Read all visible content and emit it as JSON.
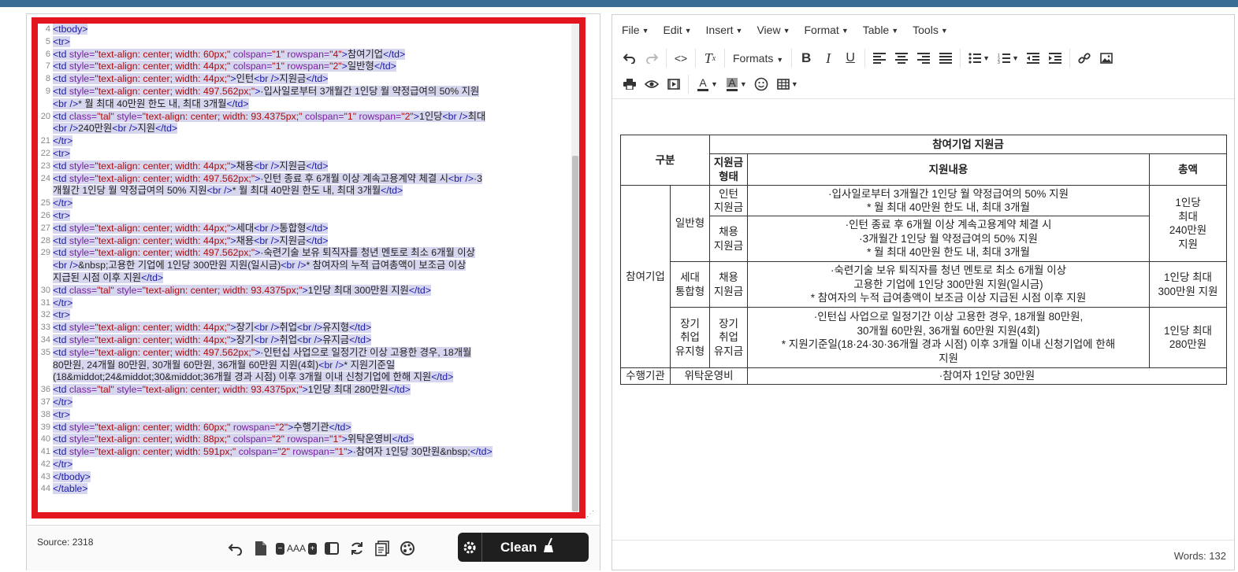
{
  "source_editor": {
    "lines": [
      {
        "n": "4",
        "html": "<span class=\"tag\">&lt;tbody&gt;</span>"
      },
      {
        "n": "5",
        "html": "<span class=\"tag\">&lt;tr&gt;</span>"
      },
      {
        "n": "6",
        "html": "<span class=\"tag\">&lt;td</span> <span class=\"attr\">style=</span><span class=\"str\">\"text-align: center; width: 60px;\"</span> <span class=\"attr\">colspan=</span><span class=\"str\">\"1\"</span> <span class=\"attr\">rowspan=</span><span class=\"str\">\"4\"</span><span class=\"tag\">&gt;</span>참여기업<span class=\"tag\">&lt;/td&gt;</span>"
      },
      {
        "n": "7",
        "html": "<span class=\"tag\">&lt;td</span> <span class=\"attr\">style=</span><span class=\"str\">\"text-align: center; width: 44px;\"</span> <span class=\"attr\">colspan=</span><span class=\"str\">\"1\"</span> <span class=\"attr\">rowspan=</span><span class=\"str\">\"2\"</span><span class=\"tag\">&gt;</span>일반형<span class=\"tag\">&lt;/td&gt;</span>"
      },
      {
        "n": "8",
        "html": "<span class=\"tag\">&lt;td</span> <span class=\"attr\">style=</span><span class=\"str\">\"text-align: center; width: 44px;\"</span><span class=\"tag\">&gt;</span>인턴<span class=\"tag\">&lt;br /&gt;</span>지원금<span class=\"tag\">&lt;/td&gt;</span>"
      },
      {
        "n": "9",
        "html": "<span class=\"tag\">&lt;td</span> <span class=\"attr\">style=</span><span class=\"str\">\"text-align: center; width: 497.562px;\"</span><span class=\"tag\">&gt;</span>·입사일로부터 3개월간 1인당 월 약정급여의 50% 지원<br><span class=\"tag\">&lt;br /&gt;</span>* 월 최대 40만원 한도 내, 최대 3개월<span class=\"tag\">&lt;/td&gt;</span>"
      },
      {
        "n": "20",
        "html": "<span class=\"tag\">&lt;td</span> <span class=\"attr\">class=</span><span class=\"str\">\"tal\"</span> <span class=\"attr\">style=</span><span class=\"str\">\"text-align: center; width: 93.4375px;\"</span> <span class=\"attr\">colspan=</span><span class=\"str\">\"1\"</span> <span class=\"attr\">rowspan=</span><span class=\"str\">\"2\"</span><span class=\"tag\">&gt;</span>1인당<span class=\"tag\">&lt;br /&gt;</span>최대<br><span class=\"tag\">&lt;br /&gt;</span>240만원<span class=\"tag\">&lt;br /&gt;</span>지원<span class=\"tag\">&lt;/td&gt;</span>"
      },
      {
        "n": "21",
        "html": "<span class=\"tag\">&lt;/tr&gt;</span>"
      },
      {
        "n": "22",
        "html": "<span class=\"tag\">&lt;tr&gt;</span>"
      },
      {
        "n": "23",
        "html": "<span class=\"tag\">&lt;td</span> <span class=\"attr\">style=</span><span class=\"str\">\"text-align: center; width: 44px;\"</span><span class=\"tag\">&gt;</span>채용<span class=\"tag\">&lt;br /&gt;</span>지원금<span class=\"tag\">&lt;/td&gt;</span>"
      },
      {
        "n": "24",
        "html": "<span class=\"tag\">&lt;td</span> <span class=\"attr\">style=</span><span class=\"str\">\"text-align: center; width: 497.562px;\"</span><span class=\"tag\">&gt;</span>·인턴 종료 후 6개월 이상 계속고용계약 체결 시<span class=\"tag\">&lt;br /&gt;</span>·3<br>개월간 1인당 월 약정급여의 50% 지원<span class=\"tag\">&lt;br /&gt;</span>* 월 최대 40만원 한도 내, 최대 3개월<span class=\"tag\">&lt;/td&gt;</span>"
      },
      {
        "n": "25",
        "html": "<span class=\"tag\">&lt;/tr&gt;</span>"
      },
      {
        "n": "26",
        "html": "<span class=\"tag\">&lt;tr&gt;</span>"
      },
      {
        "n": "27",
        "html": "<span class=\"tag\">&lt;td</span> <span class=\"attr\">style=</span><span class=\"str\">\"text-align: center; width: 44px;\"</span><span class=\"tag\">&gt;</span>세대<span class=\"tag\">&lt;br /&gt;</span>통합형<span class=\"tag\">&lt;/td&gt;</span>"
      },
      {
        "n": "28",
        "html": "<span class=\"tag\">&lt;td</span> <span class=\"attr\">style=</span><span class=\"str\">\"text-align: center; width: 44px;\"</span><span class=\"tag\">&gt;</span>채용<span class=\"tag\">&lt;br /&gt;</span>지원금<span class=\"tag\">&lt;/td&gt;</span>"
      },
      {
        "n": "29",
        "html": "<span class=\"tag\">&lt;td</span> <span class=\"attr\">style=</span><span class=\"str\">\"text-align: center; width: 497.562px;\"</span><span class=\"tag\">&gt;</span>·숙련기술 보유 퇴직자를 청년 멘토로 최소 6개월 이상<br><span class=\"tag\">&lt;br /&gt;</span>&amp;nbsp;고용한 기업에 1인당 300만원 지원(일시금)<span class=\"tag\">&lt;br /&gt;</span>* 참여자의 누적 급여총액이 보조금 이상<br>지급된 시점 이후 지원<span class=\"tag\">&lt;/td&gt;</span>"
      },
      {
        "n": "30",
        "html": "<span class=\"tag\">&lt;td</span> <span class=\"attr\">class=</span><span class=\"str\">\"tal\"</span> <span class=\"attr\">style=</span><span class=\"str\">\"text-align: center; width: 93.4375px;\"</span><span class=\"tag\">&gt;</span>1인당 최대 300만원 지원<span class=\"tag\">&lt;/td&gt;</span>"
      },
      {
        "n": "31",
        "html": "<span class=\"tag\">&lt;/tr&gt;</span>"
      },
      {
        "n": "32",
        "html": "<span class=\"tag\">&lt;tr&gt;</span>"
      },
      {
        "n": "33",
        "html": "<span class=\"tag\">&lt;td</span> <span class=\"attr\">style=</span><span class=\"str\">\"text-align: center; width: 44px;\"</span><span class=\"tag\">&gt;</span>장기<span class=\"tag\">&lt;br /&gt;</span>취업<span class=\"tag\">&lt;br /&gt;</span>유지형<span class=\"tag\">&lt;/td&gt;</span>"
      },
      {
        "n": "34",
        "html": "<span class=\"tag\">&lt;td</span> <span class=\"attr\">style=</span><span class=\"str\">\"text-align: center; width: 44px;\"</span><span class=\"tag\">&gt;</span>장기<span class=\"tag\">&lt;br /&gt;</span>취업<span class=\"tag\">&lt;br /&gt;</span>유지금<span class=\"tag\">&lt;/td&gt;</span>"
      },
      {
        "n": "35",
        "html": "<span class=\"tag\">&lt;td</span> <span class=\"attr\">style=</span><span class=\"str\">\"text-align: center; width: 497.562px;\"</span><span class=\"tag\">&gt;</span>·인턴십 사업으로 일정기간 이상 고용한 경우, 18개월<br>80만원, 24개월 80만원, 30개월 60만원, 36개월 60만원 지원(4회)<span class=\"tag\">&lt;br /&gt;</span>* 지원기준일<br>(18&amp;middot;24&amp;middot;30&amp;middot;36개월 경과 시점) 이후 3개월 이내 신청기업에 한해 지원<span class=\"tag\">&lt;/td&gt;</span>"
      },
      {
        "n": "36",
        "html": "<span class=\"tag\">&lt;td</span> <span class=\"attr\">class=</span><span class=\"str\">\"tal\"</span> <span class=\"attr\">style=</span><span class=\"str\">\"text-align: center; width: 93.4375px;\"</span><span class=\"tag\">&gt;</span>1인당 최대 280만원<span class=\"tag\">&lt;/td&gt;</span>"
      },
      {
        "n": "37",
        "html": "<span class=\"tag\">&lt;/tr&gt;</span>"
      },
      {
        "n": "38",
        "html": "<span class=\"tag\">&lt;tr&gt;</span>"
      },
      {
        "n": "39",
        "html": "<span class=\"tag\">&lt;td</span> <span class=\"attr\">style=</span><span class=\"str\">\"text-align: center; width: 60px;\"</span> <span class=\"attr\">rowspan=</span><span class=\"str\">\"2\"</span><span class=\"tag\">&gt;</span>수행기관<span class=\"tag\">&lt;/td&gt;</span>"
      },
      {
        "n": "40",
        "html": "<span class=\"tag\">&lt;td</span> <span class=\"attr\">style=</span><span class=\"str\">\"text-align: center; width: 88px;\"</span> <span class=\"attr\">colspan=</span><span class=\"str\">\"2\"</span> <span class=\"attr\">rowspan=</span><span class=\"str\">\"1\"</span><span class=\"tag\">&gt;</span>위탁운영비<span class=\"tag\">&lt;/td&gt;</span>"
      },
      {
        "n": "41",
        "html": "<span class=\"tag\">&lt;td</span> <span class=\"attr\">style=</span><span class=\"str\">\"text-align: center; width: 591px;\"</span> <span class=\"attr\">colspan=</span><span class=\"str\">\"2\"</span> <span class=\"attr\">rowspan=</span><span class=\"str\">\"1\"</span><span class=\"tag\">&gt;</span>·참여자 1인당 30만원&amp;nbsp;<span class=\"tag\">&lt;/td&gt;</span>"
      },
      {
        "n": "42",
        "html": "<span class=\"tag\">&lt;/tr&gt;</span>"
      },
      {
        "n": "43",
        "html": "<span class=\"tag\">&lt;/tbody&gt;</span>"
      },
      {
        "n": "44",
        "html": "<span class=\"tag\">&lt;/table&gt;</span>"
      }
    ],
    "source_label": "Source: 2318",
    "clean_label": "Clean",
    "icons": [
      "undo-icon",
      "new-document-icon",
      "decrease-font-icon",
      "font-size-label",
      "increase-font-icon",
      "wrap-icon",
      "refresh-icon",
      "copy-icon",
      "palette-icon"
    ],
    "font_size_label": "AAA"
  },
  "wysiwyg": {
    "menu": [
      "File",
      "Edit",
      "Insert",
      "View",
      "Format",
      "Table",
      "Tools"
    ],
    "formats_label": "Formats",
    "words": "Words: 132",
    "table": {
      "header": {
        "category": "구분",
        "group": "참여기업 지원금",
        "type": "지원금\n형태",
        "content": "지원내용",
        "total": "총액"
      },
      "company": "참여기업",
      "general": "일반형",
      "intern_type": "인턴\n지원금",
      "intern_content": "·입사일로부터 3개월간 1인당 월 약정급여의 50% 지원\n* 월 최대 40만원 한도 내, 최대 3개월",
      "general_total": "1인당\n최대\n240만원\n지원",
      "hire_type": "채용\n지원금",
      "hire_content": "·인턴 종료 후 6개월 이상 계속고용계약 체결 시\n·3개월간 1인당 월 약정급여의 50% 지원\n* 월 최대 40만원 한도 내, 최대 3개월",
      "gen_integrated": "세대\n통합형",
      "gen_type": "채용\n지원금",
      "gen_content": "·숙련기술 보유 퇴직자를 청년 멘토로 최소 6개월 이상\n고용한 기업에 1인당 300만원 지원(일시금)\n* 참여자의 누적 급여총액이 보조금 이상 지급된 시점 이후 지원",
      "gen_total": "1인당 최대\n300만원 지원",
      "long_term": "장기\n취업\n유지형",
      "long_type": "장기\n취업\n유지금",
      "long_content": "·인턴십 사업으로 일정기간 이상 고용한 경우, 18개월 80만원,\n30개월 60만원, 36개월 60만원 지원(4회)\n* 지원기준일(18·24·30·36개월 경과 시점) 이후 3개월 이내 신청기업에 한해\n지원",
      "long_total": "1인당 최대\n280만원",
      "agency": "수행기관",
      "agency_type": "위탁운영비",
      "agency_content": "·참여자 1인당 30만원"
    }
  }
}
